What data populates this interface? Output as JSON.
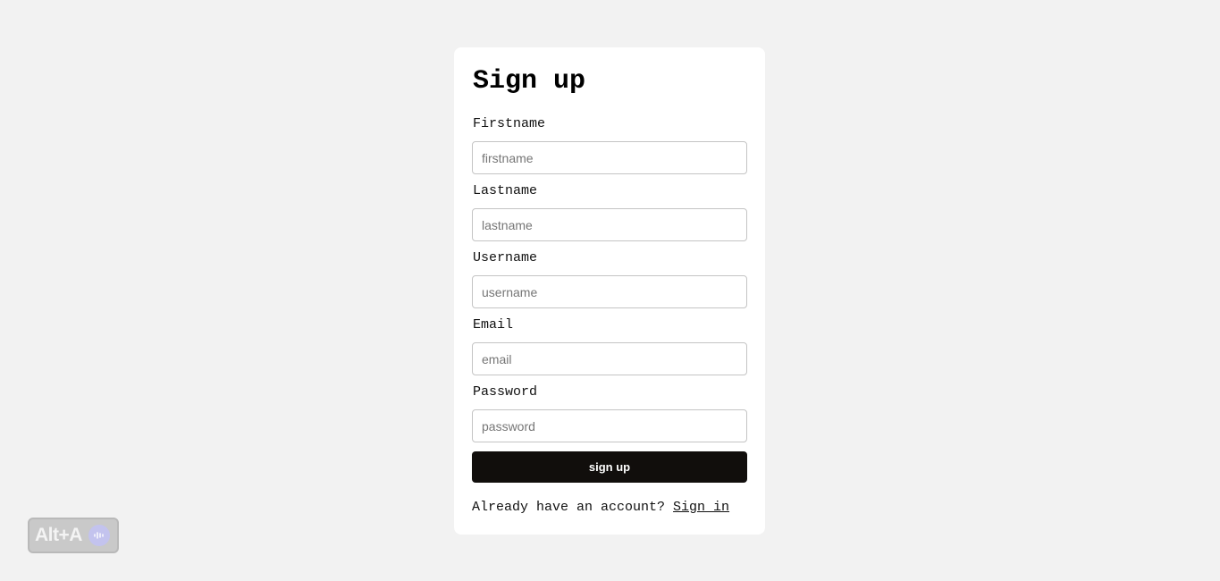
{
  "form": {
    "title": "Sign up",
    "fields": [
      {
        "label": "Firstname",
        "placeholder": "firstname",
        "value": ""
      },
      {
        "label": "Lastname",
        "placeholder": "lastname",
        "value": ""
      },
      {
        "label": "Username",
        "placeholder": "username",
        "value": ""
      },
      {
        "label": "Email",
        "placeholder": "email",
        "value": ""
      },
      {
        "label": "Password",
        "placeholder": "password",
        "value": ""
      }
    ],
    "submit_label": "sign up",
    "footer_text": "Already have an account? ",
    "signin_link": "Sign in"
  },
  "overlay": {
    "shortcut_label": "Alt+A",
    "icon": "audio-wave-icon"
  },
  "colors": {
    "background": "#f2f2f2",
    "card": "#ffffff",
    "button": "#110e0c",
    "badge": "#c9c9c9",
    "badge_icon": "#c3c3ee"
  }
}
